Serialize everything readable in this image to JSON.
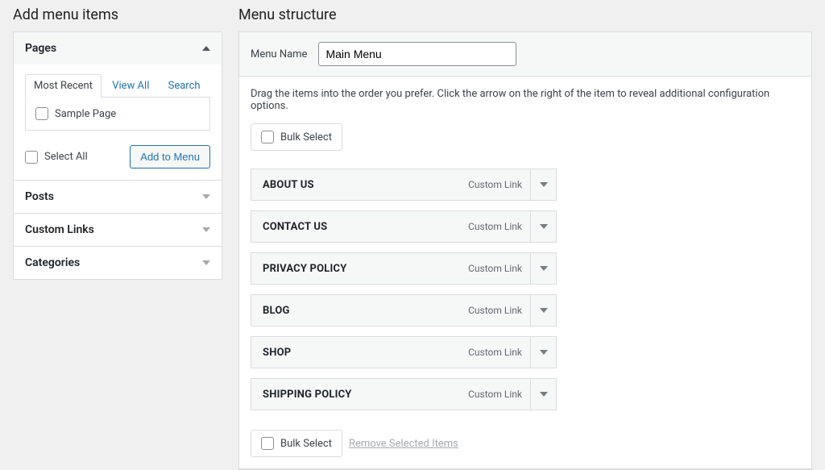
{
  "left": {
    "title": "Add menu items",
    "accordion": [
      {
        "label": "Pages",
        "open": true
      },
      {
        "label": "Posts",
        "open": false
      },
      {
        "label": "Custom Links",
        "open": false
      },
      {
        "label": "Categories",
        "open": false
      }
    ],
    "tabs": {
      "recent": "Most Recent",
      "all": "View All",
      "search": "Search"
    },
    "sample_page": "Sample Page",
    "select_all": "Select All",
    "add_button": "Add to Menu"
  },
  "right": {
    "title": "Menu structure",
    "menu_name_label": "Menu Name",
    "menu_name_value": "Main Menu",
    "hint": "Drag the items into the order you prefer. Click the arrow on the right of the item to reveal additional configuration options.",
    "bulk_select": "Bulk Select",
    "remove_selected": "Remove Selected Items",
    "item_type_label": "Custom Link",
    "items": [
      {
        "title": "ABOUT US"
      },
      {
        "title": "CONTACT US"
      },
      {
        "title": "PRIVACY POLICY"
      },
      {
        "title": "BLOG"
      },
      {
        "title": "SHOP"
      },
      {
        "title": "SHIPPING POLICY"
      }
    ]
  }
}
